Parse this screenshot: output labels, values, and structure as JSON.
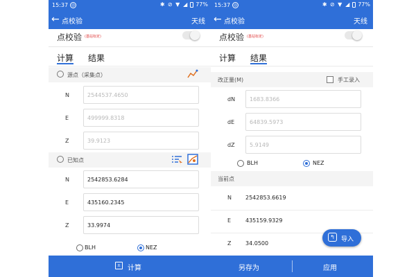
{
  "status": {
    "time": "15:37",
    "battery": "77%"
  },
  "appbar": {
    "title": "点校验",
    "action": "天线"
  },
  "calibration": {
    "title": "点校验",
    "subtitle_left": "(基站标定)",
    "subtitle_right": "(基站标定)"
  },
  "tabs": {
    "calc": "计算",
    "result": "结果"
  },
  "left": {
    "source_header": "源点（采集点）",
    "source_fields": [
      {
        "label": "N",
        "placeholder": "2544537.4650"
      },
      {
        "label": "E",
        "placeholder": "499999.8318"
      },
      {
        "label": "Z",
        "placeholder": "39.9123"
      }
    ],
    "known_header": "已知点",
    "known_fields": [
      {
        "label": "N",
        "value": "2542853.6284"
      },
      {
        "label": "E",
        "value": "435160.2345"
      },
      {
        "label": "Z",
        "value": "33.9974"
      }
    ],
    "radio": {
      "blh": "BLH",
      "nez": "NEZ",
      "selected": "NEZ"
    },
    "bottom_label": "计算"
  },
  "right": {
    "corr_header": "改正量(M)",
    "manual_label": "手工录入",
    "corr_fields": [
      {
        "label": "dN",
        "placeholder": "1683.8366"
      },
      {
        "label": "dE",
        "placeholder": "64839.5973"
      },
      {
        "label": "dZ",
        "placeholder": "5.9149"
      }
    ],
    "radio": {
      "blh": "BLH",
      "nez": "NEZ",
      "selected": "NEZ"
    },
    "current_header": "当前点",
    "current_rows": [
      {
        "label": "N",
        "value": "2542853.6619"
      },
      {
        "label": "E",
        "value": "435159.9329"
      },
      {
        "label": "Z",
        "value": "34.0500"
      }
    ],
    "import_label": "导入",
    "save_as_label": "另存为",
    "apply_label": "应用"
  },
  "colors": {
    "accent": "#2f6fd8",
    "warning": "#e04040"
  },
  "icons": [
    "back-arrow-icon",
    "target-icon",
    "trend-icon",
    "list-pick-icon",
    "map-pick-icon",
    "calculator-icon",
    "import-icon"
  ]
}
